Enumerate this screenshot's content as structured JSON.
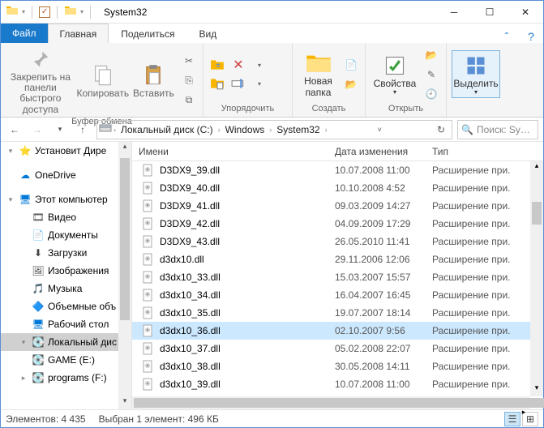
{
  "title": "System32",
  "tabs": {
    "file": "Файл",
    "home": "Главная",
    "share": "Поделиться",
    "view": "Вид"
  },
  "ribbon": {
    "pin": "Закрепить на панели быстрого доступа",
    "copy": "Копировать",
    "paste": "Вставить",
    "clipboard_group": "Буфер обмена",
    "organize_group": "Упорядочить",
    "new_folder": "Новая папка",
    "new_group": "Создать",
    "properties": "Свойства",
    "open_group": "Открыть",
    "select": "Выделить"
  },
  "breadcrumb": [
    "Локальный диск (C:)",
    "Windows",
    "System32"
  ],
  "search_placeholder": "Поиск: Sy…",
  "nav": [
    {
      "label": "Установит Дире",
      "icon": "star",
      "color": "#f7b500",
      "indent": 0,
      "exp": "▾"
    },
    {
      "label": "",
      "spacer": true
    },
    {
      "label": "OneDrive",
      "icon": "cloud",
      "color": "#0078d7",
      "indent": 0
    },
    {
      "label": "",
      "spacer": true
    },
    {
      "label": "Этот компьютер",
      "icon": "pc",
      "color": "#0078d7",
      "indent": 0,
      "exp": "▾"
    },
    {
      "label": "Видео",
      "icon": "video",
      "color": "#444",
      "indent": 1
    },
    {
      "label": "Документы",
      "icon": "doc",
      "color": "#444",
      "indent": 1
    },
    {
      "label": "Загрузки",
      "icon": "down",
      "color": "#444",
      "indent": 1
    },
    {
      "label": "Изображения",
      "icon": "pic",
      "color": "#444",
      "indent": 1
    },
    {
      "label": "Музыка",
      "icon": "music",
      "color": "#0078d7",
      "indent": 1
    },
    {
      "label": "Объемные объ",
      "icon": "cube",
      "color": "#00a0b0",
      "indent": 1
    },
    {
      "label": "Рабочий стол",
      "icon": "desk",
      "color": "#0078d7",
      "indent": 1
    },
    {
      "label": "Локальный дис",
      "icon": "drive",
      "color": "#888",
      "indent": 1,
      "sel": true,
      "exp": "▾"
    },
    {
      "label": "GAME (E:)",
      "icon": "drive",
      "color": "#888",
      "indent": 1
    },
    {
      "label": "programs (F:)",
      "icon": "drive",
      "color": "#888",
      "indent": 1,
      "exp": "▸"
    }
  ],
  "columns": {
    "name": "Имени",
    "date": "Дата изменения",
    "type": "Тип"
  },
  "files": [
    {
      "name": "D3DX9_39.dll",
      "date": "10.07.2008 11:00",
      "type": "Расширение при."
    },
    {
      "name": "D3DX9_40.dll",
      "date": "10.10.2008 4:52",
      "type": "Расширение при."
    },
    {
      "name": "D3DX9_41.dll",
      "date": "09.03.2009 14:27",
      "type": "Расширение при."
    },
    {
      "name": "D3DX9_42.dll",
      "date": "04.09.2009 17:29",
      "type": "Расширение при."
    },
    {
      "name": "D3DX9_43.dll",
      "date": "26.05.2010 11:41",
      "type": "Расширение при."
    },
    {
      "name": "d3dx10.dll",
      "date": "29.11.2006 12:06",
      "type": "Расширение при."
    },
    {
      "name": "d3dx10_33.dll",
      "date": "15.03.2007 15:57",
      "type": "Расширение при."
    },
    {
      "name": "d3dx10_34.dll",
      "date": "16.04.2007 16:45",
      "type": "Расширение при."
    },
    {
      "name": "d3dx10_35.dll",
      "date": "19.07.2007 18:14",
      "type": "Расширение при."
    },
    {
      "name": "d3dx10_36.dll",
      "date": "02.10.2007 9:56",
      "type": "Расширение при.",
      "sel": true
    },
    {
      "name": "d3dx10_37.dll",
      "date": "05.02.2008 22:07",
      "type": "Расширение при."
    },
    {
      "name": "d3dx10_38.dll",
      "date": "30.05.2008 14:11",
      "type": "Расширение при."
    },
    {
      "name": "d3dx10_39.dll",
      "date": "10.07.2008 11:00",
      "type": "Расширение при."
    }
  ],
  "status": {
    "items": "Элементов: 4 435",
    "selected": "Выбран 1 элемент: 496 КБ"
  }
}
